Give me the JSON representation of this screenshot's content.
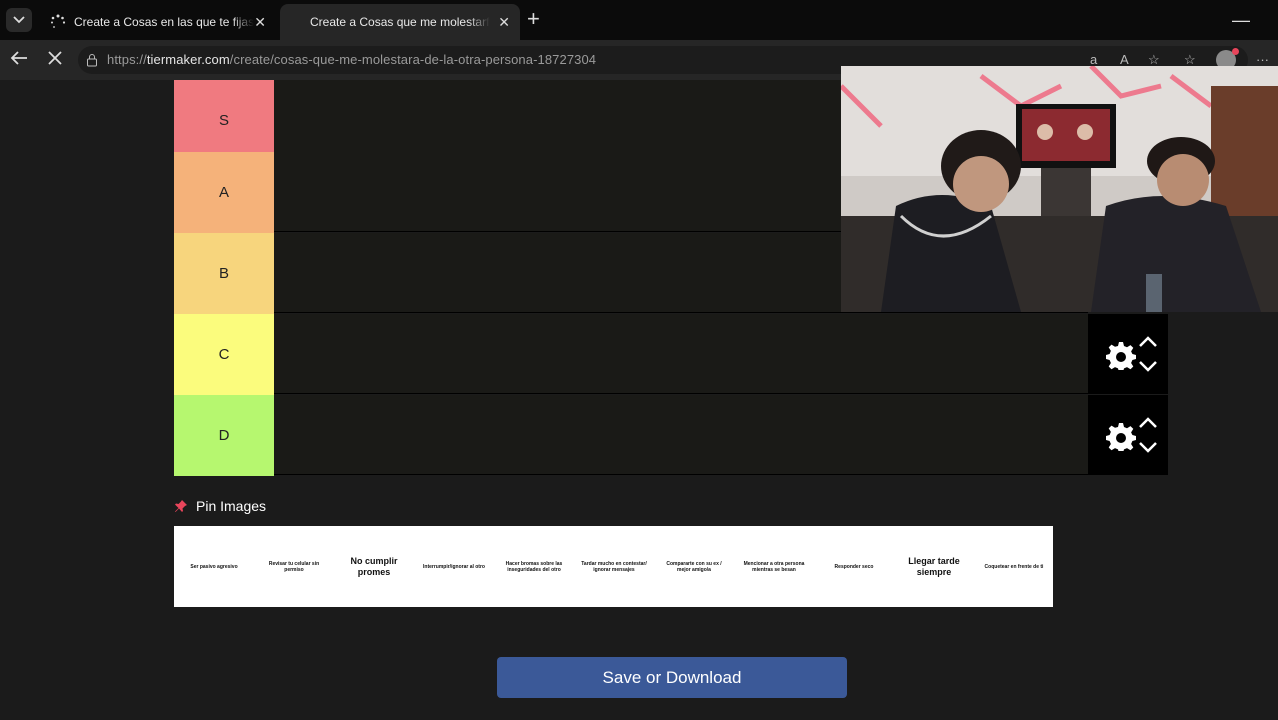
{
  "browser": {
    "tabs": [
      {
        "title": "Create a Cosas en las que te fijas e",
        "active": false
      },
      {
        "title": "Create a Cosas que me molestarfa",
        "active": true
      }
    ],
    "url_prefix": "https://",
    "url_domain": "tiermaker.com",
    "url_path": "/create/cosas-que-me-molestara-de-la-otra-persona-18727304"
  },
  "tiers": [
    {
      "label": "S",
      "color": "#f07a80"
    },
    {
      "label": "A",
      "color": "#f5b27a"
    },
    {
      "label": "B",
      "color": "#f7d57d"
    },
    {
      "label": "C",
      "color": "#fbfc7d"
    },
    {
      "label": "D",
      "color": "#b6f76f"
    }
  ],
  "pin_images_label": "Pin Images",
  "items": [
    {
      "text": "Ser pasivo agresivo"
    },
    {
      "text": "Revisar tu celular sin permiso"
    },
    {
      "text": "No cumplir promes",
      "big": true
    },
    {
      "text": "Interrumpir/ignorar al otro"
    },
    {
      "text": "Hacer bromas sobre las inseguridades del otro"
    },
    {
      "text": "Tardar mucho en contestar/ ignorar mensajes"
    },
    {
      "text": "Compararte con su ex / mejor amigo/a"
    },
    {
      "text": "Mencionar a otra persona mientras se besan"
    },
    {
      "text": "Responder seco"
    },
    {
      "text": "Llegar tarde siempre",
      "big": true
    },
    {
      "text": "Coquetear en frente de ti"
    }
  ],
  "save_button": "Save or Download",
  "colors": {
    "save_button": "#3b5998",
    "page_bg": "#1b1b1b"
  }
}
